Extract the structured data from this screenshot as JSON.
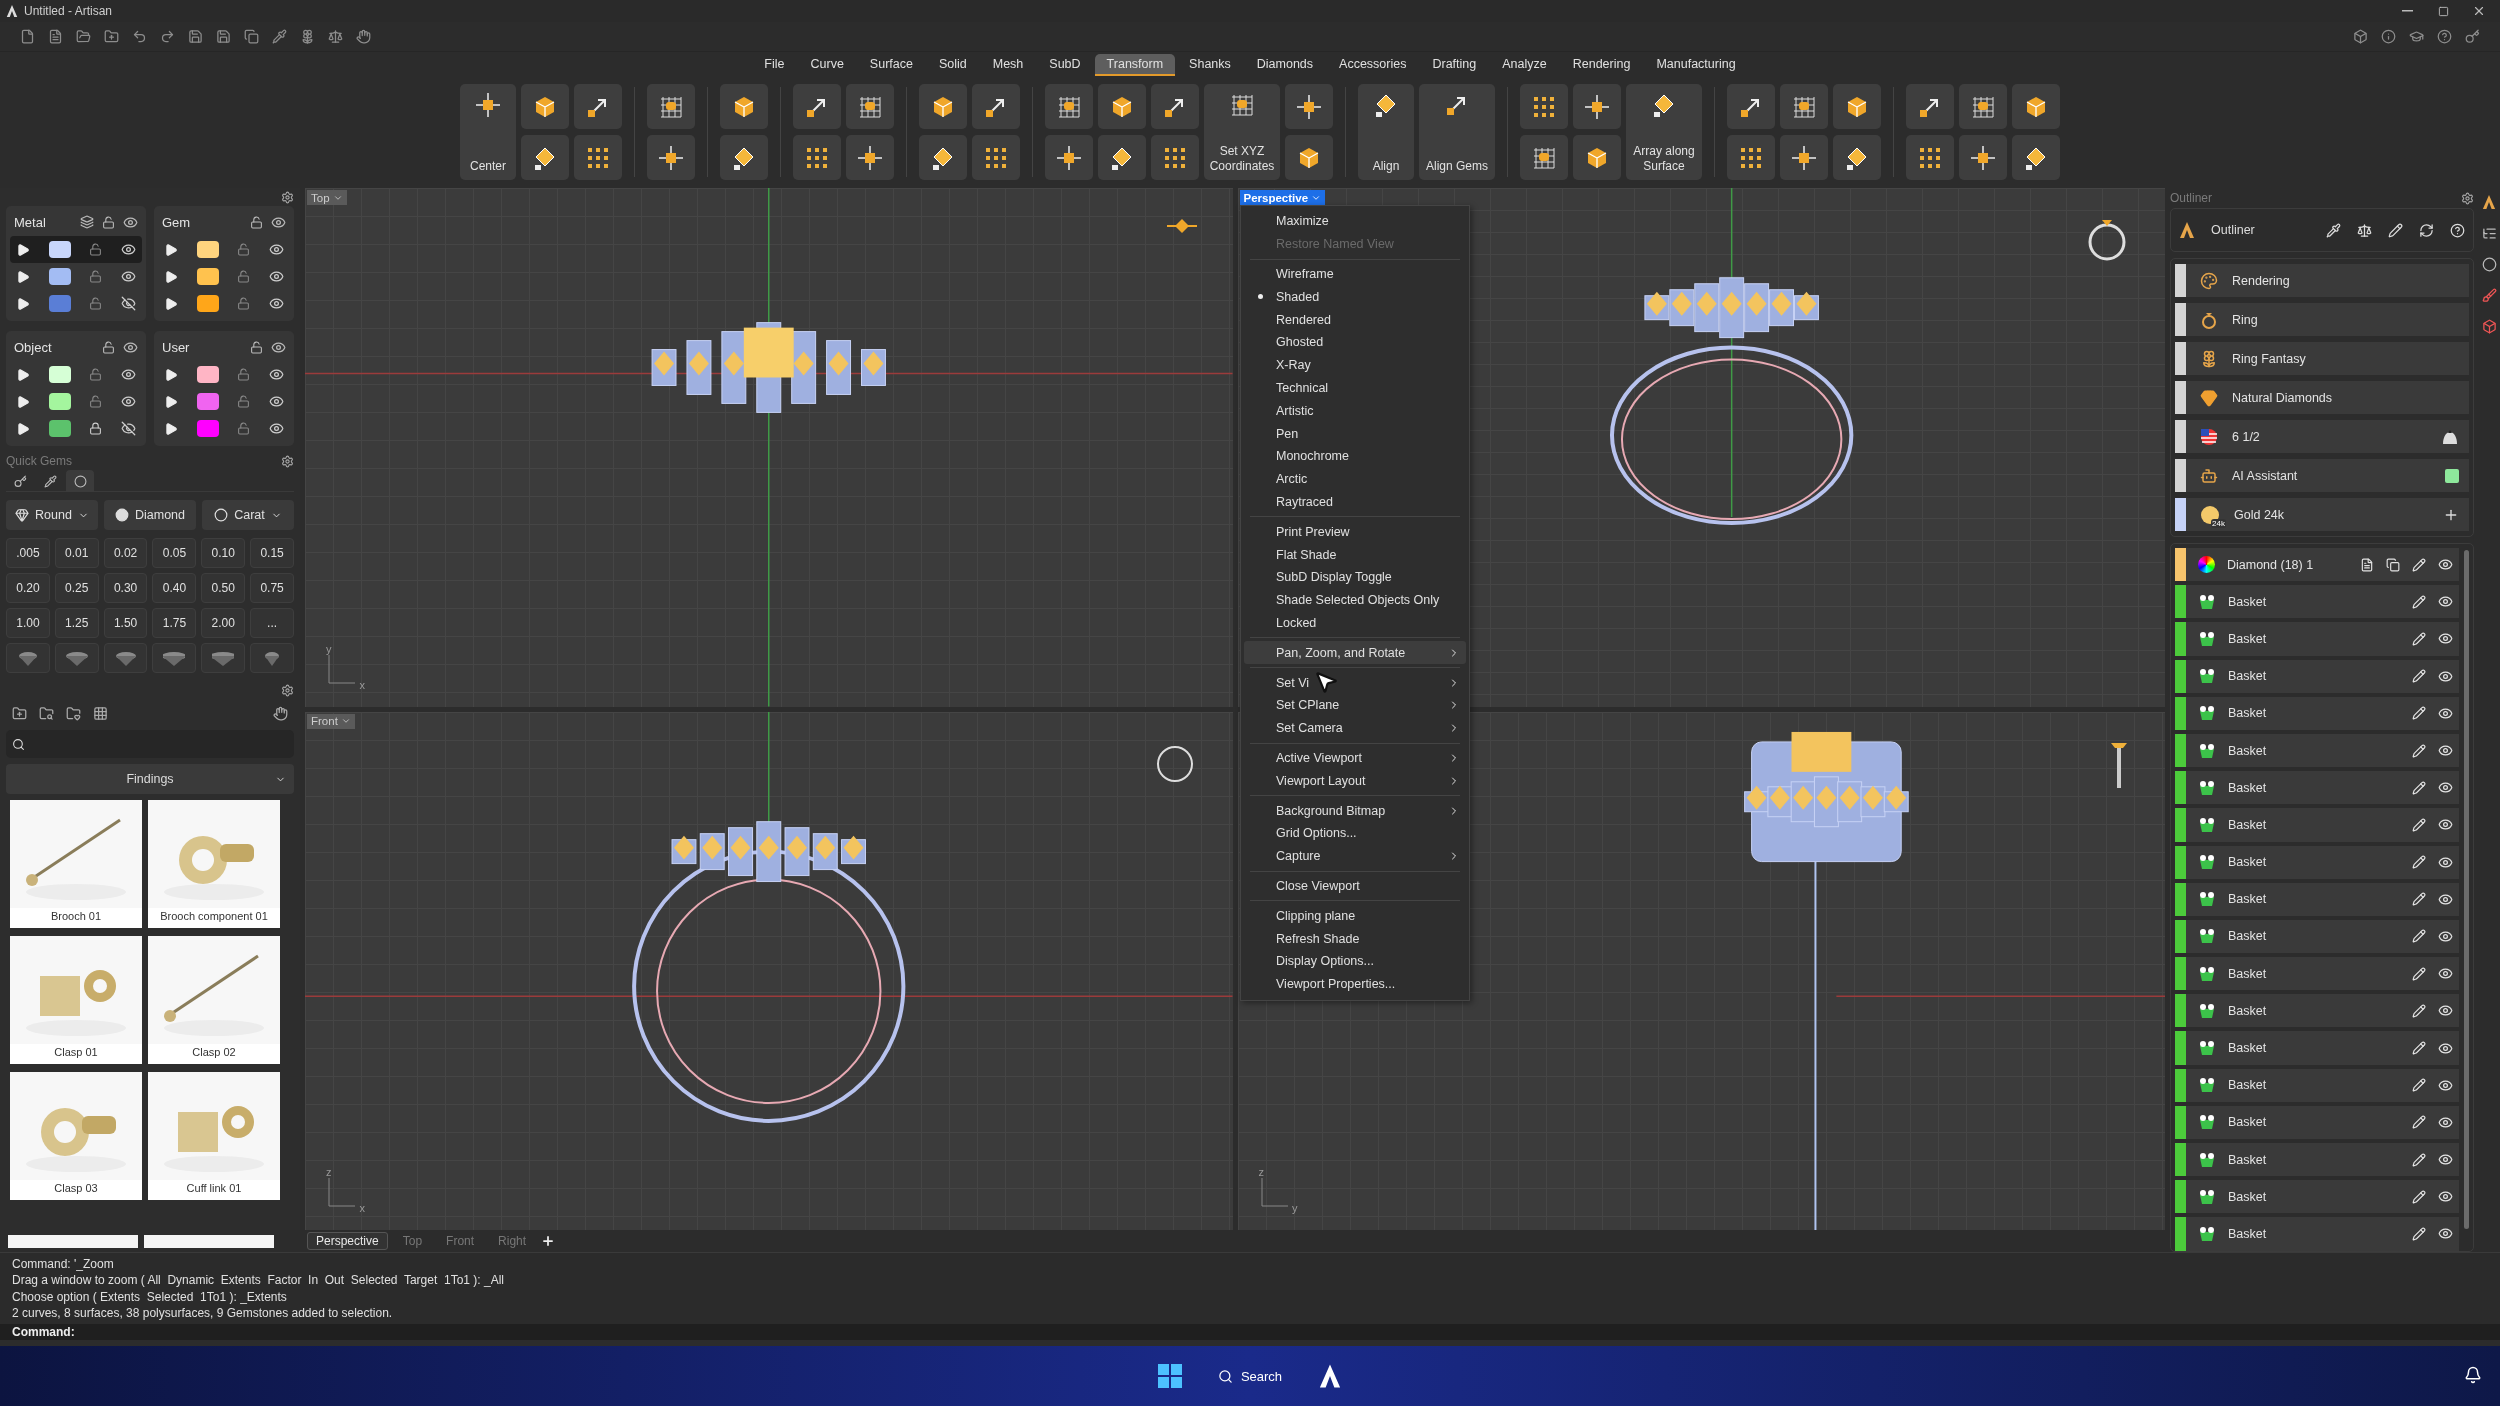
{
  "window": {
    "title": "Untitled - Artisan"
  },
  "menu_tabs": [
    {
      "label": "File",
      "selected": false
    },
    {
      "label": "Curve",
      "selected": false
    },
    {
      "label": "Surface",
      "selected": false
    },
    {
      "label": "Solid",
      "selected": false
    },
    {
      "label": "Mesh",
      "selected": false
    },
    {
      "label": "SubD",
      "selected": false
    },
    {
      "label": "Transform",
      "selected": true
    },
    {
      "label": "Shanks",
      "selected": false
    },
    {
      "label": "Diamonds",
      "selected": false
    },
    {
      "label": "Accessories",
      "selected": false
    },
    {
      "label": "Drafting",
      "selected": false
    },
    {
      "label": "Analyze",
      "selected": false
    },
    {
      "label": "Rendering",
      "selected": false
    },
    {
      "label": "Manufacturing",
      "selected": false
    }
  ],
  "ribbon": [
    {
      "buttons": [
        {
          "kind": "large",
          "label": "Center"
        },
        {
          "kind": "pair"
        },
        {
          "kind": "pair"
        }
      ]
    },
    {
      "buttons": [
        {
          "kind": "pair"
        }
      ]
    },
    {
      "buttons": [
        {
          "kind": "pair"
        }
      ]
    },
    {
      "buttons": [
        {
          "kind": "pair"
        },
        {
          "kind": "pair"
        }
      ]
    },
    {
      "buttons": [
        {
          "kind": "pair"
        },
        {
          "kind": "pair"
        }
      ]
    },
    {
      "buttons": [
        {
          "kind": "pair"
        },
        {
          "kind": "pair"
        },
        {
          "kind": "pair"
        },
        {
          "kind": "large",
          "label": "Set XYZ Coordinates"
        },
        {
          "kind": "pair"
        }
      ]
    },
    {
      "buttons": [
        {
          "kind": "large",
          "label": "Align"
        },
        {
          "kind": "large",
          "label": "Align Gems"
        }
      ]
    },
    {
      "buttons": [
        {
          "kind": "pair"
        },
        {
          "kind": "pair"
        },
        {
          "kind": "large",
          "label": "Array along Surface"
        }
      ]
    },
    {
      "buttons": [
        {
          "kind": "pair"
        },
        {
          "kind": "pair"
        },
        {
          "kind": "pair"
        }
      ]
    },
    {
      "buttons": [
        {
          "kind": "pair"
        },
        {
          "kind": "pair"
        },
        {
          "kind": "pair"
        }
      ]
    }
  ],
  "layer_groups": [
    {
      "name": "Metal",
      "layers": [
        {
          "color": "#c8d6fb",
          "locked": false,
          "visible": true,
          "selected": true
        },
        {
          "color": "#a3bcf3",
          "locked": false,
          "visible": true,
          "selected": false
        },
        {
          "color": "#5a7ed6",
          "locked": false,
          "visible": false,
          "selected": false
        }
      ]
    },
    {
      "name": "Gem",
      "layers": [
        {
          "color": "#ffd47e",
          "locked": false,
          "visible": true,
          "selected": false
        },
        {
          "color": "#ffc24e",
          "locked": false,
          "visible": true,
          "selected": false
        },
        {
          "color": "#ffa619",
          "locked": false,
          "visible": true,
          "selected": false
        }
      ]
    },
    {
      "name": "Object",
      "layers": [
        {
          "color": "#d6ffd6",
          "locked": false,
          "visible": true,
          "selected": false
        },
        {
          "color": "#a4f59e",
          "locked": false,
          "visible": true,
          "selected": false
        },
        {
          "color": "#5cc26c",
          "locked": true,
          "visible": false,
          "selected": false
        }
      ]
    },
    {
      "name": "User",
      "layers": [
        {
          "color": "#ffb5c5",
          "locked": false,
          "visible": true,
          "selected": false
        },
        {
          "color": "#f064f0",
          "locked": false,
          "visible": true,
          "selected": false
        },
        {
          "color": "#ff00ff",
          "locked": false,
          "visible": true,
          "selected": false
        }
      ]
    }
  ],
  "quick_gems": {
    "title": "Quick Gems",
    "tabs": [
      {
        "selected": false
      },
      {
        "selected": false
      },
      {
        "selected": true
      }
    ],
    "shape": "Round",
    "material": "Diamond",
    "unit": "Carat",
    "sizes": [
      ".005",
      "0.01",
      "0.02",
      "0.05",
      "0.10",
      "0.15",
      "0.20",
      "0.25",
      "0.30",
      "0.40",
      "0.50",
      "0.75",
      "1.00",
      "1.25",
      "1.50",
      "1.75",
      "2.00",
      "..."
    ]
  },
  "library": {
    "category": "Findings",
    "items": [
      {
        "label": "Brooch 01"
      },
      {
        "label": "Brooch component 01"
      },
      {
        "label": "Clasp 01"
      },
      {
        "label": "Clasp 02"
      },
      {
        "label": "Clasp 03"
      },
      {
        "label": "Cuff link 01"
      }
    ]
  },
  "viewports": [
    {
      "title": "Top",
      "active": false,
      "axes": [
        "y",
        "x"
      ]
    },
    {
      "title": "Perspective",
      "active": true
    },
    {
      "title": "Front",
      "active": false,
      "axes": [
        "z",
        "x"
      ]
    },
    {
      "axes": [
        "z",
        "y"
      ]
    }
  ],
  "context_menu": {
    "sections": [
      [
        {
          "label": "Maximize",
          "checked": false,
          "disabled": false,
          "submenu": false,
          "selected": false
        },
        {
          "label": "Restore Named View",
          "checked": false,
          "disabled": true,
          "submenu": false,
          "selected": false
        }
      ],
      [
        {
          "label": "Wireframe",
          "checked": false,
          "disabled": false,
          "submenu": false,
          "selected": false
        },
        {
          "label": "Shaded",
          "checked": true,
          "disabled": false,
          "submenu": false,
          "selected": false
        },
        {
          "label": "Rendered",
          "checked": false,
          "disabled": false,
          "submenu": false,
          "selected": false
        },
        {
          "label": "Ghosted",
          "checked": false,
          "disabled": false,
          "submenu": false,
          "selected": false
        },
        {
          "label": "X-Ray",
          "checked": false,
          "disabled": false,
          "submenu": false,
          "selected": false
        },
        {
          "label": "Technical",
          "checked": false,
          "disabled": false,
          "submenu": false,
          "selected": false
        },
        {
          "label": "Artistic",
          "checked": false,
          "disabled": false,
          "submenu": false,
          "selected": false
        },
        {
          "label": "Pen",
          "checked": false,
          "disabled": false,
          "submenu": false,
          "selected": false
        },
        {
          "label": "Monochrome",
          "checked": false,
          "disabled": false,
          "submenu": false,
          "selected": false
        },
        {
          "label": "Arctic",
          "checked": false,
          "disabled": false,
          "submenu": false,
          "selected": false
        },
        {
          "label": "Raytraced",
          "checked": false,
          "disabled": false,
          "submenu": false,
          "selected": false
        }
      ],
      [
        {
          "label": "Print Preview",
          "checked": false,
          "disabled": false,
          "submenu": false,
          "selected": false
        },
        {
          "label": "Flat Shade",
          "checked": false,
          "disabled": false,
          "submenu": false,
          "selected": false
        },
        {
          "label": "SubD Display Toggle",
          "checked": false,
          "disabled": false,
          "submenu": false,
          "selected": false
        },
        {
          "label": "Shade Selected Objects Only",
          "checked": false,
          "disabled": false,
          "submenu": false,
          "selected": false
        },
        {
          "label": "Locked",
          "checked": false,
          "disabled": false,
          "submenu": false,
          "selected": false
        }
      ],
      [
        {
          "label": "Pan, Zoom, and Rotate",
          "checked": false,
          "disabled": false,
          "submenu": true,
          "selected": true
        }
      ],
      [
        {
          "label": "Set Vi",
          "checked": false,
          "disabled": false,
          "submenu": true,
          "selected": false
        },
        {
          "label": "Set CPlane",
          "checked": false,
          "disabled": false,
          "submenu": true,
          "selected": false
        },
        {
          "label": "Set Camera",
          "checked": false,
          "disabled": false,
          "submenu": true,
          "selected": false
        }
      ],
      [
        {
          "label": "Active Viewport",
          "checked": false,
          "disabled": false,
          "submenu": true,
          "selected": false
        },
        {
          "label": "Viewport Layout",
          "checked": false,
          "disabled": false,
          "submenu": true,
          "selected": false
        }
      ],
      [
        {
          "label": "Background Bitmap",
          "checked": false,
          "disabled": false,
          "submenu": true,
          "selected": false
        },
        {
          "label": "Grid Options...",
          "checked": false,
          "disabled": false,
          "submenu": false,
          "selected": false
        },
        {
          "label": "Capture",
          "checked": false,
          "disabled": false,
          "submenu": true,
          "selected": false
        }
      ],
      [
        {
          "label": "Close Viewport",
          "checked": false,
          "disabled": false,
          "submenu": false,
          "selected": false
        }
      ],
      [
        {
          "label": "Clipping plane",
          "checked": false,
          "disabled": false,
          "submenu": false,
          "selected": false
        },
        {
          "label": "Refresh Shade",
          "checked": false,
          "disabled": false,
          "submenu": false,
          "selected": false
        },
        {
          "label": "Display Options...",
          "checked": false,
          "disabled": false,
          "submenu": false,
          "selected": false
        },
        {
          "label": "Viewport Properties...",
          "checked": false,
          "disabled": false,
          "submenu": false,
          "selected": false
        }
      ]
    ]
  },
  "view_tabs": [
    {
      "label": "Perspective",
      "selected": true
    },
    {
      "label": "Top",
      "selected": false
    },
    {
      "label": "Front",
      "selected": false
    },
    {
      "label": "Right",
      "selected": false
    }
  ],
  "outliner": {
    "panel_title": "Outliner",
    "title": "Outliner",
    "presets": [
      {
        "label": "Rendering",
        "color": "#d4d4d4",
        "kind": "plain"
      },
      {
        "label": "Ring",
        "color": "#d4d4d4",
        "kind": "plain"
      },
      {
        "label": "Ring Fantasy",
        "color": "#d4d4d4",
        "kind": "plain"
      },
      {
        "label": "Natural Diamonds",
        "color": "#d4d4d4",
        "kind": "plain"
      },
      {
        "label": "6 1/2",
        "color": "#d4d4d4",
        "kind": "stand"
      },
      {
        "label": "AI Assistant",
        "color": "#d4d4d4",
        "kind": "swatch"
      },
      {
        "label": "Gold 24k",
        "color": "#c6d3f8",
        "kind": "add",
        "badge": "24k"
      }
    ],
    "layers": [
      {
        "label": "Diamond (18) 1",
        "color": "#f7c46c",
        "kind": "group"
      },
      {
        "label": "Basket",
        "color": "#4ccb3b",
        "kind": "item"
      },
      {
        "label": "Basket",
        "color": "#4ccb3b",
        "kind": "item"
      },
      {
        "label": "Basket",
        "color": "#4ccb3b",
        "kind": "item"
      },
      {
        "label": "Basket",
        "color": "#4ccb3b",
        "kind": "item"
      },
      {
        "label": "Basket",
        "color": "#4ccb3b",
        "kind": "item"
      },
      {
        "label": "Basket",
        "color": "#4ccb3b",
        "kind": "item"
      },
      {
        "label": "Basket",
        "color": "#4ccb3b",
        "kind": "item"
      },
      {
        "label": "Basket",
        "color": "#4ccb3b",
        "kind": "item"
      },
      {
        "label": "Basket",
        "color": "#4ccb3b",
        "kind": "item"
      },
      {
        "label": "Basket",
        "color": "#4ccb3b",
        "kind": "item"
      },
      {
        "label": "Basket",
        "color": "#4ccb3b",
        "kind": "item"
      },
      {
        "label": "Basket",
        "color": "#4ccb3b",
        "kind": "item"
      },
      {
        "label": "Basket",
        "color": "#4ccb3b",
        "kind": "item"
      },
      {
        "label": "Basket",
        "color": "#4ccb3b",
        "kind": "item"
      },
      {
        "label": "Basket",
        "color": "#4ccb3b",
        "kind": "item"
      },
      {
        "label": "Basket",
        "color": "#4ccb3b",
        "kind": "item"
      },
      {
        "label": "Basket",
        "color": "#4ccb3b",
        "kind": "item"
      },
      {
        "label": "Basket",
        "color": "#4ccb3b",
        "kind": "item"
      }
    ]
  },
  "command": {
    "history": [
      "Command: '_Zoom",
      "Drag a window to zoom ( All  Dynamic  Extents  Factor  In  Out  Selected  Target  1To1 ): _All",
      "Choose option ( Extents  Selected  1To1 ): _Extents",
      "2 curves, 8 surfaces, 38 polysurfaces, 9 Gemstones added to selection."
    ],
    "prompt": "Command:"
  },
  "taskbar": {
    "search": "Search"
  }
}
